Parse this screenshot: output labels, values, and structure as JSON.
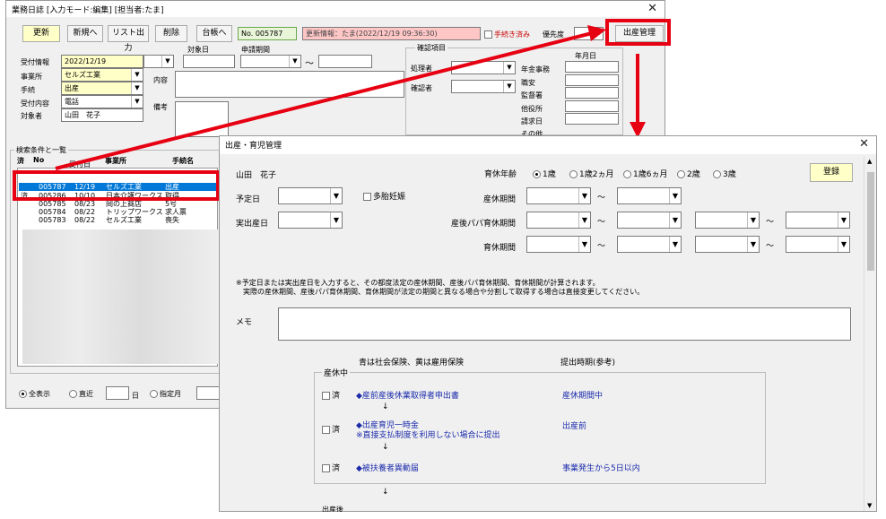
{
  "main": {
    "title": "業務日誌 [入力モード:編集] [担当者:たま]",
    "toolbar": {
      "update": "更新",
      "new": "新規へ",
      "list": "リスト出力",
      "delete": "削除",
      "ledger": "台帳へ",
      "no": "No. 005787",
      "info": "更新情報：たま(2022/12/19 09:36:30)",
      "done": "手続き済み",
      "priority": "優先度",
      "birth": "出産管理"
    },
    "form": {
      "target_date": "対象日",
      "apply_period": "申請期間",
      "tilde": "～",
      "receipt_label": "受付情報",
      "receipt_date": "2022/12/19",
      "office_label": "事業所",
      "office": "セルズ工業",
      "proc_label": "手続",
      "proc": "出産",
      "content_label": "受付内容",
      "content": "電話",
      "person_label": "対象者",
      "person": "山田　花子",
      "naiyo": "内容",
      "biko": "備考"
    },
    "confirm": {
      "legend": "確認項目",
      "handler": "処理者",
      "confirmer": "確認者",
      "ymd": "年月日",
      "items": [
        "年金事務",
        "職安",
        "監督署",
        "他役所",
        "請求日",
        "その他"
      ]
    },
    "list": {
      "legend": "検索条件と一覧",
      "col_done": "済",
      "col_no": "No",
      "col_date": "受付日",
      "col_office": "事業所",
      "col_proc": "手続名",
      "rows": [
        {
          "done": "",
          "no": "005787",
          "date": "12/19",
          "office": "セルズ工業",
          "proc": "出産"
        },
        {
          "done": "済",
          "no": "005286",
          "date": "10/10",
          "office": "日本介護ワークス",
          "proc": "取得"
        },
        {
          "done": "",
          "no": "005785",
          "date": "08/23",
          "office": "岡の上商店",
          "proc": "5号"
        },
        {
          "done": "",
          "no": "005784",
          "date": "08/22",
          "office": "トリップワークス",
          "proc": "求人票"
        },
        {
          "done": "",
          "no": "005783",
          "date": "08/22",
          "office": "セルズ工業",
          "proc": "喪失"
        }
      ]
    },
    "filter": {
      "all": "全表示",
      "recent": "直近",
      "day": "日",
      "specified": "指定月"
    }
  },
  "dialog": {
    "title": "出産・育児管理",
    "person": "山田　花子",
    "age_label": "育休年齢",
    "age_options": [
      "1歳",
      "1歳2ヵ月",
      "1歳6ヵ月",
      "2歳",
      "3歳"
    ],
    "register": "登録",
    "due_label": "予定日",
    "twins": "多胎妊娠",
    "actual_label": "実出産日",
    "maternity_label": "産休期間",
    "papa_label": "産後パパ育休期間",
    "childcare_label": "育休期間",
    "tilde": "～",
    "note1": "※予定日または実出産日を入力すると、その都度法定の産休期間、産後パパ育休期間、育休期間が計算されます。",
    "note2": "実際の産休期間、産後パパ育休期間、育休期間が法定の期間と異なる場合や分割して取得する場合は直接変更してください。",
    "memo_label": "メモ",
    "legend_note": "青は社会保険、黄は雇用保険",
    "timing_header": "提出時期(参考)",
    "group_label": "産休中",
    "done_label": "済",
    "items": [
      {
        "name": "◆産前産後休業取得者申出書",
        "sub": "",
        "timing": "産休期間中"
      },
      {
        "name": "◆出産育児一時金",
        "sub": "※直接支払制度を利用しない場合に提出",
        "timing": "出産前"
      },
      {
        "name": "◆被扶養者異動届",
        "sub": "",
        "timing": "事業発生から5日以内"
      }
    ],
    "arrow": "↓",
    "next_group": "出産後"
  },
  "colors": {
    "highlight": "#e60012",
    "select": "#0078d7",
    "blue_text": "#1b2bab",
    "no_box": "#e8f5d8",
    "info_box": "#ffc6c6"
  }
}
